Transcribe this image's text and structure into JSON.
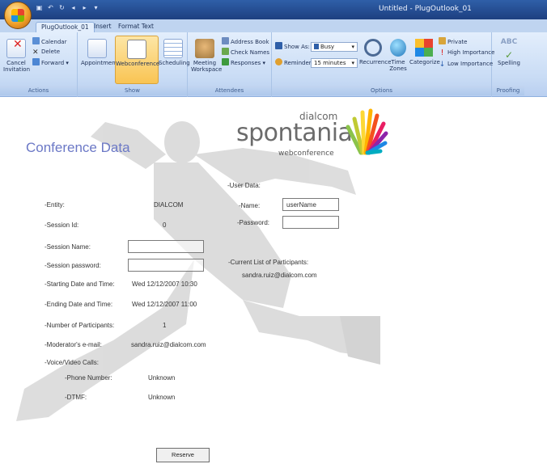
{
  "window": {
    "title": "Untitled - PlugOutlook_01"
  },
  "qat_icons": [
    "save-icon",
    "undo-icon",
    "redo-icon",
    "back-icon",
    "forward-icon",
    "dropdown-icon"
  ],
  "tabs": [
    {
      "label": "PlugOutlook_01",
      "active": true
    },
    {
      "label": "Insert",
      "active": false
    },
    {
      "label": "Format Text",
      "active": false
    }
  ],
  "ribbon": {
    "actions": {
      "label": "Actions",
      "cancel": "Cancel\nInvitation",
      "calendar": "Calendar",
      "delete": "Delete",
      "forward": "Forward"
    },
    "show": {
      "label": "Show",
      "appointment": "Appointment",
      "webconference": "Webconference",
      "scheduling": "Scheduling"
    },
    "attendees": {
      "label": "Attendees",
      "meeting_workspace": "Meeting\nWorkspace",
      "address_book": "Address Book",
      "check_names": "Check Names",
      "responses": "Responses"
    },
    "options": {
      "label": "Options",
      "show_as": "Show As:",
      "show_as_value": "Busy",
      "reminder": "Reminder:",
      "reminder_value": "15 minutes",
      "recurrence": "Recurrence",
      "time_zones": "Time\nZones",
      "categorize": "Categorize",
      "private": "Private",
      "high_importance": "High Importance",
      "low_importance": "Low Importance"
    },
    "proofing": {
      "label": "Proofing",
      "spelling": "Spelling",
      "abc": "ABC"
    }
  },
  "brand": {
    "top": "dialcom",
    "main": "spontania",
    "sub": "webconference"
  },
  "form": {
    "heading": "Conference Data",
    "entity_label": "-Entity:",
    "entity_value": "DIALCOM",
    "session_id_label": "-Session Id:",
    "session_id_value": "0",
    "session_name_label": "-Session Name:",
    "session_password_label": "-Session password:",
    "starting_label": "-Starting Date and Time:",
    "starting_value": "Wed 12/12/2007 10:30",
    "ending_label": "-Ending Date and Time:",
    "ending_value": "Wed 12/12/2007 11:00",
    "participants_label": "-Number of Participants:",
    "participants_value": "1",
    "moderator_label": "-Moderator's e-mail:",
    "moderator_value": "sandra.ruiz@dialcom.com",
    "voice_label": "-Voice/Video Calls:",
    "phone_label": "-Phone Number:",
    "phone_value": "Unknown",
    "dtmf_label": "-DTMF:",
    "dtmf_value": "Unknown",
    "user_data_label": "-User Data:",
    "name_label": "-Name:",
    "name_value": "userName",
    "password_label": "-Password:",
    "participants_list_label": "-Current List of Participants:",
    "participants_list_value": "sandra.ruiz@dialcom.com",
    "reserve_button": "Reserve Conference"
  }
}
